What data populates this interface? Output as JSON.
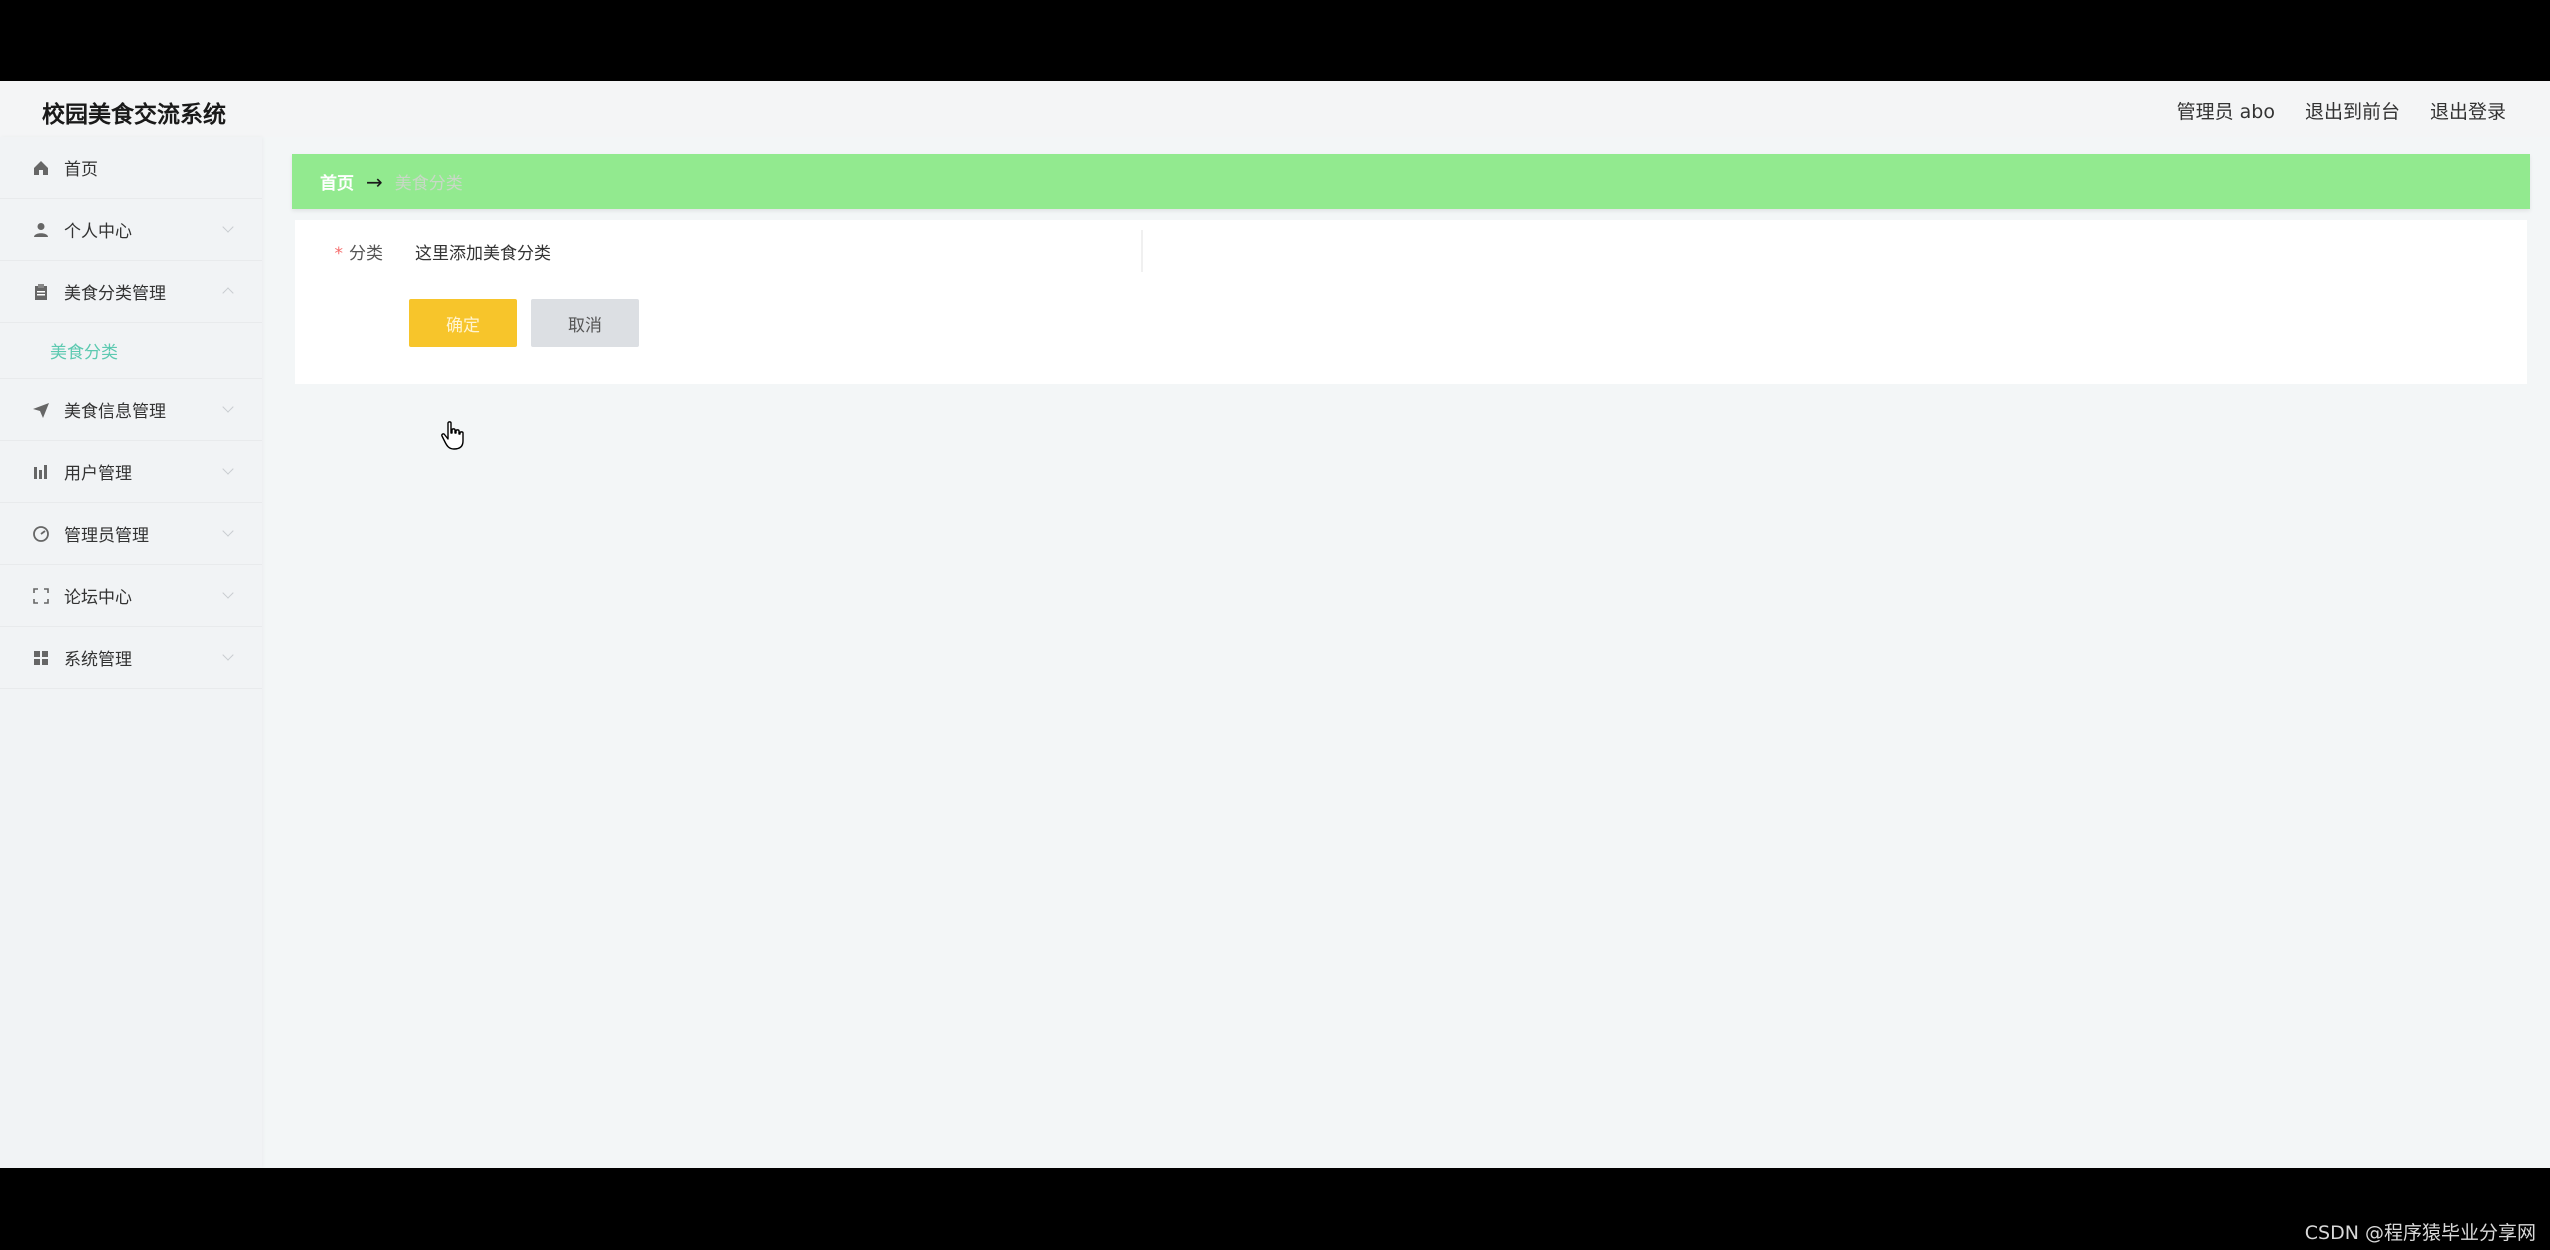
{
  "app": {
    "title": "校园美食交流系统"
  },
  "header": {
    "admin_label": "管理员 abo",
    "exit_to_front": "退出到前台",
    "logout": "退出登录"
  },
  "sidebar": {
    "items": [
      {
        "label": "首页",
        "icon": "home-icon"
      },
      {
        "label": "个人中心",
        "icon": "user-icon"
      },
      {
        "label": "美食分类管理",
        "icon": "clipboard-icon"
      },
      {
        "label": "美食信息管理",
        "icon": "send-icon"
      },
      {
        "label": "用户管理",
        "icon": "bar-chart-icon"
      },
      {
        "label": "管理员管理",
        "icon": "gauge-icon"
      },
      {
        "label": "论坛中心",
        "icon": "frame-icon"
      },
      {
        "label": "系统管理",
        "icon": "grid-icon"
      }
    ],
    "active_submenu": "美食分类"
  },
  "breadcrumb": {
    "home": "首页",
    "separator": "→",
    "current": "美食分类"
  },
  "form": {
    "field_label": "分类",
    "required_mark": "*",
    "field_value": "这里添加美食分类",
    "confirm_label": "确定",
    "cancel_label": "取消"
  },
  "watermark": "CSDN @程序猿毕业分享网",
  "colors": {
    "breadcrumb_bg": "#92ea8f",
    "confirm_bg": "#f7c52b",
    "cancel_bg": "#dcdfe3",
    "submenu_active": "#5cc9b0"
  }
}
